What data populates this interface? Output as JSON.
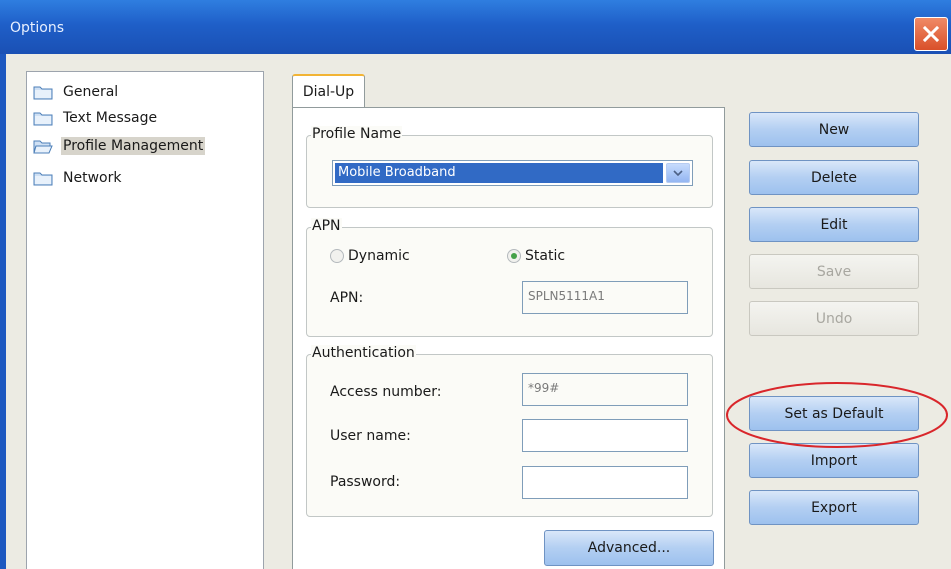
{
  "window": {
    "title": "Options",
    "close_icon": "close-icon"
  },
  "tree": {
    "items": [
      {
        "label": "General",
        "icon": "folder-icon",
        "selected": false
      },
      {
        "label": "Text Message",
        "icon": "folder-icon",
        "selected": false
      },
      {
        "label": "Profile Management",
        "icon": "folder-open-icon",
        "selected": true
      },
      {
        "label": "Network",
        "icon": "folder-icon",
        "selected": false
      }
    ]
  },
  "tabs": {
    "active": "Dial-Up"
  },
  "profile": {
    "legend": "Profile Name",
    "selected_value": "Mobile Broadband"
  },
  "apn": {
    "legend": "APN",
    "dynamic_label": "Dynamic",
    "static_label": "Static",
    "selected": "Static",
    "apn_label": "APN:",
    "apn_value": "SPLN5111A1"
  },
  "auth": {
    "legend": "Authentication",
    "access_label": "Access number:",
    "access_value": "*99#",
    "user_label": "User name:",
    "user_value": "",
    "password_label": "Password:",
    "password_value": ""
  },
  "buttons": {
    "new": "New",
    "delete": "Delete",
    "edit": "Edit",
    "save": "Save",
    "undo": "Undo",
    "set_default": "Set as Default",
    "import": "Import",
    "export": "Export",
    "advanced": "Advanced..."
  },
  "colors": {
    "titlebar": "#1f5fc8",
    "selection": "#316ac5",
    "highlight_ellipse": "#d9262b"
  }
}
